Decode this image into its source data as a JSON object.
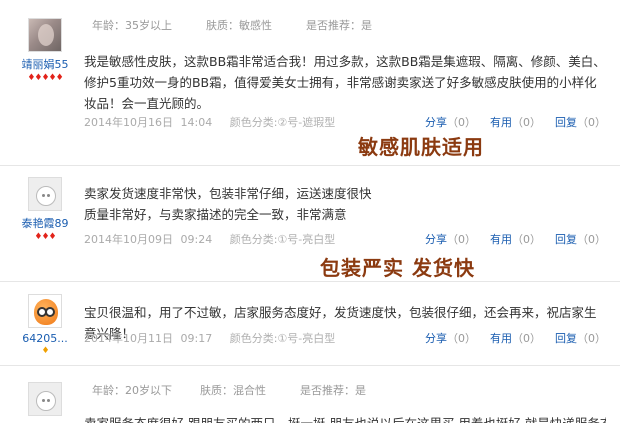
{
  "reviews": [
    {
      "username": "靖丽娟55",
      "badges": "♦♦♦♦♦",
      "meta": {
        "age": "年龄：35岁以上",
        "skin": "肤质：敏感性",
        "recommend": "是否推荐：是"
      },
      "content": "我是敏感性皮肤，这款BB霜非常适合我！用过多款，这款BB霜是集遮瑕、隔离、修颜、美白、修护5重功效一身的BB霜，值得爱美女士拥有，非常感谢卖家送了好多敏感皮肤使用的小样化妆品！会一直光顾的。",
      "date": "2014年10月16日",
      "time": "14:04",
      "color_category": "颜色分类:②号-遮瑕型",
      "share_label": "分享",
      "share_count": "（0）",
      "useful_label": "有用",
      "useful_count": "（0）",
      "reply_label": "回复",
      "reply_count": "（0）",
      "overlay": "敏感肌肤适用"
    },
    {
      "username": "泰艳霞89",
      "badges": "♦♦♦",
      "content_line1": "卖家发货速度非常快，包装非常仔细，运送速度很快",
      "content_line2": "质量非常好，与卖家描述的完全一致，非常满意",
      "date": "2014年10月09日",
      "time": "09:24",
      "color_category": "颜色分类:①号-亮白型",
      "share_label": "分享",
      "share_count": "（0）",
      "useful_label": "有用",
      "useful_count": "（0）",
      "reply_label": "回复",
      "reply_count": "（0）",
      "overlay": "包装严实 发货快"
    },
    {
      "username": "64205...",
      "badges": "♦",
      "content": "宝贝很温和，用了不过敏，店家服务态度好，发货速度快，包装很仔细，还会再来，祝店家生意兴隆！",
      "date": "2014年10月11日",
      "time": "09:17",
      "color_category": "颜色分类:①号-亮白型",
      "share_label": "分享",
      "share_count": "（0）",
      "useful_label": "有用",
      "useful_count": "（0）",
      "reply_label": "回复",
      "reply_count": "（0）"
    },
    {
      "meta": {
        "age": "年龄：20岁以下",
        "skin": "肤质：混合性",
        "recommend": "是否推荐：是"
      },
      "content": "卖家服务态度很好 跟朋友买的两只，挺一挺 朋友也说以后在这里买 用着也挺好 就是快递服务态度不"
    }
  ],
  "colors": {
    "link": "#1a5db0",
    "overlay": "#8b3a10",
    "badge_red": "#e2231a",
    "badge_yellow": "#f0a000"
  }
}
